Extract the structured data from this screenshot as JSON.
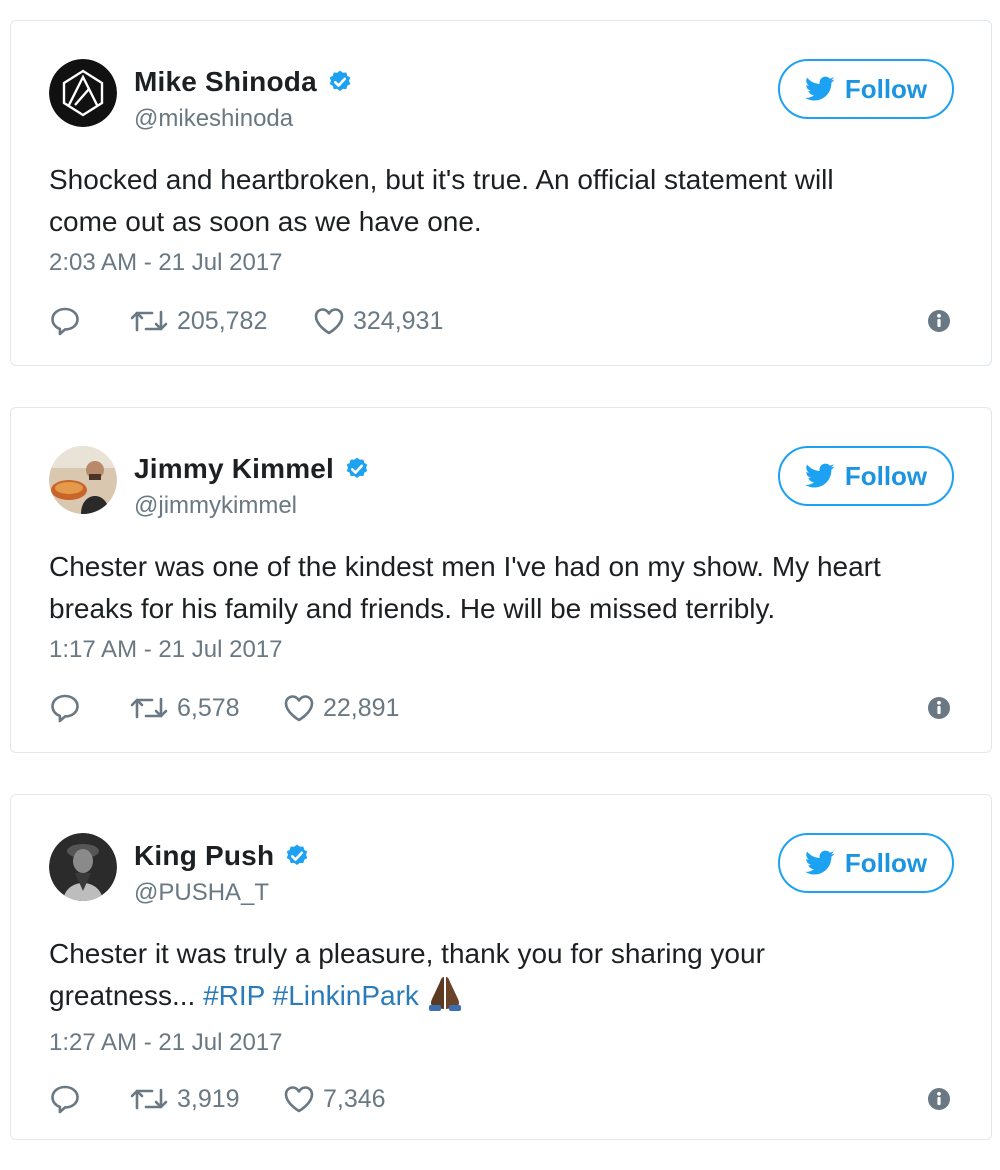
{
  "colors": {
    "accent": "#1da1f2",
    "link": "#2b7bb9",
    "muted": "#697882",
    "verified": "#1da1f2",
    "border": "#e1e8ed"
  },
  "tweets": [
    {
      "author": {
        "name": "Mike Shinoda",
        "handle": "@mikeshinoda",
        "verified": true,
        "avatar_icon": "linkin-park-logo-avatar"
      },
      "follow_label": "Follow",
      "text": "Shocked and heartbroken, but it's true. An official statement will\ncome out as soon as we have one.",
      "timestamp": "2:03 AM - 21 Jul 2017",
      "retweets": "205,782",
      "likes": "324,931",
      "icons": {
        "reply": "reply-icon",
        "retweet": "retweet-icon",
        "like": "heart-icon",
        "info": "info-icon"
      }
    },
    {
      "author": {
        "name": "Jimmy Kimmel",
        "handle": "@jimmykimmel",
        "verified": true,
        "avatar_icon": "photo-avatar"
      },
      "follow_label": "Follow",
      "text": "Chester was one of the kindest men I've had on my show. My heart\nbreaks for his family and friends. He will be missed terribly.",
      "timestamp": "1:17 AM - 21 Jul 2017",
      "retweets": "6,578",
      "likes": "22,891",
      "icons": {
        "reply": "reply-icon",
        "retweet": "retweet-icon",
        "like": "heart-icon",
        "info": "info-icon"
      }
    },
    {
      "author": {
        "name": "King Push",
        "handle": "@PUSHA_T",
        "verified": true,
        "avatar_icon": "photo-avatar"
      },
      "follow_label": "Follow",
      "text_plain": "Chester it was truly a pleasure, thank you for sharing your\ngreatness... ",
      "hashtags": [
        "#RIP",
        "#LinkinPark"
      ],
      "emoji": "folded-hands-emoji",
      "timestamp": "1:27 AM - 21 Jul 2017",
      "retweets": "3,919",
      "likes": "7,346",
      "icons": {
        "reply": "reply-icon",
        "retweet": "retweet-icon",
        "like": "heart-icon",
        "info": "info-icon"
      }
    }
  ]
}
